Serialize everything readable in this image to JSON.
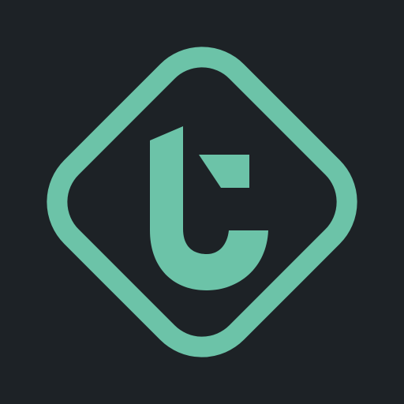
{
  "icon": {
    "name": "letter-t-logo-icon",
    "background_color": "#1d2226",
    "accent_color": "#6cc3a8"
  }
}
